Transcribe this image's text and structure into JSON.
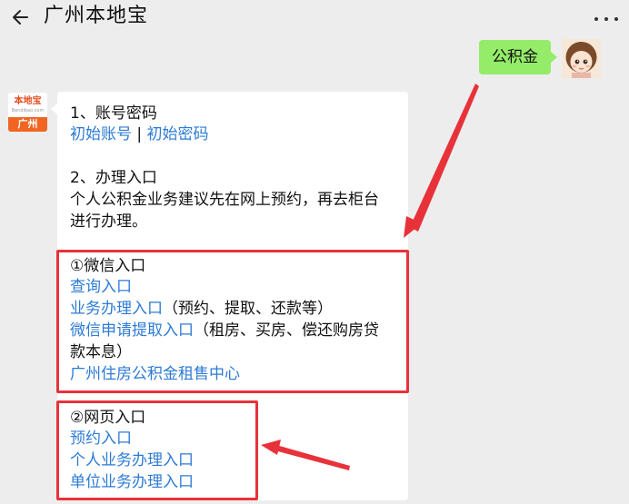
{
  "header": {
    "title": "广州本地宝"
  },
  "chat": {
    "me_message": "公积金",
    "bot_avatar": {
      "brand": "本地宝",
      "url": "Bendibao.com",
      "city": "广州"
    },
    "section1": {
      "heading": "1、账号密码",
      "link_account": "初始账号",
      "separator": "|",
      "link_password": "初始密码"
    },
    "section2": {
      "heading": "2、办理入口",
      "desc_line1": "个人公积金业务建议先在网上预约，再去柜台",
      "desc_line2": "进行办理。"
    },
    "wechat": {
      "heading": "①微信入口",
      "link_query": "查询入口",
      "link_business": "业务办理入口",
      "business_note": "（预约、提取、还款等）",
      "link_withdraw": "微信申请提取入口",
      "withdraw_note": "（租房、买房、偿还购房贷",
      "withdraw_note2": "款本息）",
      "link_rental": "广州住房公积金租售中心"
    },
    "web": {
      "heading": "②网页入口",
      "link_booking": "预约入口",
      "link_personal": "个人业务办理入口",
      "link_company": "单位业务办理入口"
    }
  },
  "colors": {
    "link": "#2d7bd5",
    "me_bubble": "#95ec69",
    "highlight_red": "#e8323a",
    "background": "#ededed"
  }
}
